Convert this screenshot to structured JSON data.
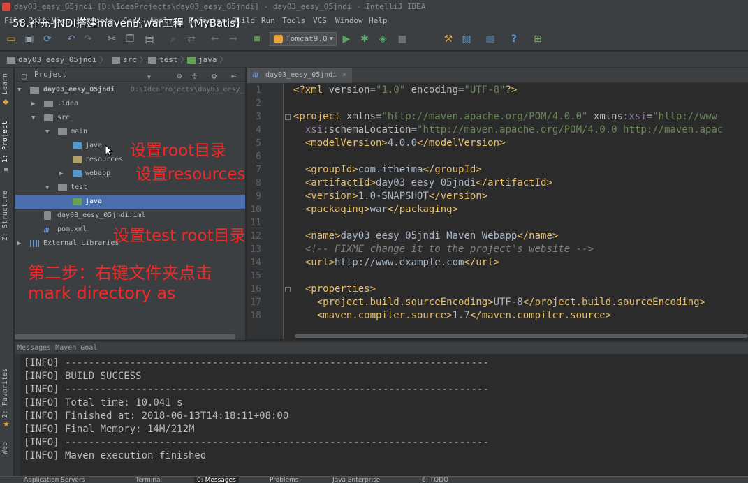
{
  "window": {
    "title": "day03_eesy_05jndi [D:\\IdeaProjects\\day03_eesy_05jndi] - day03_eesy_05jndi - IntelliJ IDEA",
    "overlay_title": "58.补充-JNDI搭建maven的war工程【MyBatis】"
  },
  "menu": [
    "File",
    "Edit",
    "View",
    "Navigate",
    "Code",
    "Analyze",
    "Refactor",
    "Build",
    "Run",
    "Tools",
    "VCS",
    "Window",
    "Help"
  ],
  "toolbar": {
    "run_config": "Tomcat9.0",
    "icons": [
      "open-icon",
      "save-icon",
      "sync-icon",
      "undo-icon",
      "redo-icon",
      "cut-icon",
      "copy-icon",
      "paste-icon",
      "find-icon",
      "replace-icon",
      "back-icon",
      "forward-icon",
      "build-icon",
      "run-icon",
      "debug-icon",
      "coverage-icon",
      "stop-icon",
      "project-structure-icon",
      "sdk-icon",
      "help-icon",
      "vcs-icon"
    ]
  },
  "breadcrumb": [
    "day03_eesy_05jndi",
    "src",
    "test",
    "java"
  ],
  "left_strip": {
    "tab_learn": "Learn",
    "tab_project": "1: Project",
    "tab_structure": "Z: Structure",
    "tab_favorites": "2: Favorites",
    "tab_web": "Web"
  },
  "project_panel": {
    "title": "Project",
    "tree": [
      {
        "label": "day03_eesy_05jndi",
        "hint": "D:\\IdeaProjects\\day03_eesy_",
        "level": 0,
        "arrow": "▼",
        "icon": "module"
      },
      {
        "label": ".idea",
        "level": 1,
        "arrow": "▶",
        "icon": "folder"
      },
      {
        "label": "src",
        "level": 1,
        "arrow": "▼",
        "icon": "folder"
      },
      {
        "label": "main",
        "level": 2,
        "arrow": "▼",
        "icon": "folder"
      },
      {
        "label": "java",
        "level": 3,
        "arrow": "",
        "icon": "source"
      },
      {
        "label": "resources",
        "level": 3,
        "arrow": "",
        "icon": "resource"
      },
      {
        "label": "webapp",
        "level": 3,
        "arrow": "▶",
        "icon": "folder"
      },
      {
        "label": "test",
        "level": 2,
        "arrow": "▼",
        "icon": "folder"
      },
      {
        "label": "java",
        "level": 3,
        "arrow": "",
        "icon": "test",
        "selected": true
      },
      {
        "label": "day03_eesy_05jndi.iml",
        "level": 1,
        "arrow": "",
        "icon": "iml"
      },
      {
        "label": "pom.xml",
        "level": 1,
        "arrow": "",
        "icon": "maven"
      },
      {
        "label": "External Libraries",
        "level": 0,
        "arrow": "▶",
        "icon": "lib"
      }
    ]
  },
  "annotations": {
    "root": "设置root目录",
    "resources": "设置resources目录",
    "test_root": "设置test root目录",
    "step_line1": "第二步：右键文件夹点击",
    "step_line2": "mark directory as"
  },
  "editor": {
    "tab_label": "day03_eesy_05jndi",
    "line_numbers": [
      "1",
      "2",
      "3",
      "4",
      "5",
      "6",
      "7",
      "8",
      "9",
      "10",
      "11",
      "12",
      "13",
      "14",
      "15",
      "16",
      "17",
      "18"
    ],
    "lines": [
      [
        {
          "t": "<?xml ",
          "c": "tag"
        },
        {
          "t": "version",
          "c": "attr"
        },
        {
          "t": "=",
          "c": "txt"
        },
        {
          "t": "\"1.0\"",
          "c": "val"
        },
        {
          "t": " encoding",
          "c": "attr"
        },
        {
          "t": "=",
          "c": "txt"
        },
        {
          "t": "\"UTF-8\"",
          "c": "val"
        },
        {
          "t": "?>",
          "c": "tag"
        }
      ],
      [],
      [
        {
          "t": "<project ",
          "c": "tag"
        },
        {
          "t": "xmlns",
          "c": "attr"
        },
        {
          "t": "=",
          "c": "txt"
        },
        {
          "t": "\"http://maven.apache.org/POM/4.0.0\"",
          "c": "val"
        },
        {
          "t": " xmlns",
          "c": "attr"
        },
        {
          "t": ":",
          "c": "txt"
        },
        {
          "t": "xsi",
          "c": "ns"
        },
        {
          "t": "=",
          "c": "txt"
        },
        {
          "t": "\"http://www",
          "c": "val"
        }
      ],
      [
        {
          "t": "  xsi",
          "c": "ns"
        },
        {
          "t": ":schemaLocation",
          "c": "attr"
        },
        {
          "t": "=",
          "c": "txt"
        },
        {
          "t": "\"http://maven.apache.org/POM/4.0.0 http://maven.apac",
          "c": "val"
        }
      ],
      [
        {
          "t": "  <modelVersion>",
          "c": "tag"
        },
        {
          "t": "4.0.0",
          "c": "txt"
        },
        {
          "t": "</modelVersion>",
          "c": "tag"
        }
      ],
      [],
      [
        {
          "t": "  <groupId>",
          "c": "tag"
        },
        {
          "t": "com.itheima",
          "c": "txt"
        },
        {
          "t": "</groupId>",
          "c": "tag"
        }
      ],
      [
        {
          "t": "  <artifactId>",
          "c": "tag"
        },
        {
          "t": "day03_eesy_05jndi",
          "c": "txt"
        },
        {
          "t": "</artifactId>",
          "c": "tag"
        }
      ],
      [
        {
          "t": "  <version>",
          "c": "tag"
        },
        {
          "t": "1.0-SNAPSHOT",
          "c": "txt"
        },
        {
          "t": "</version>",
          "c": "tag"
        }
      ],
      [
        {
          "t": "  <packaging>",
          "c": "tag"
        },
        {
          "t": "war",
          "c": "txt"
        },
        {
          "t": "</packaging>",
          "c": "tag"
        }
      ],
      [],
      [
        {
          "t": "  <name>",
          "c": "tag"
        },
        {
          "t": "day03_eesy_05jndi Maven Webapp",
          "c": "txt"
        },
        {
          "t": "</name>",
          "c": "tag"
        }
      ],
      [
        {
          "t": "  <!-- ",
          "c": "cmt"
        },
        {
          "t": "FIXME change it to the project's website",
          "c": "cmt"
        },
        {
          "t": " -->",
          "c": "cmt"
        }
      ],
      [
        {
          "t": "  <url>",
          "c": "tag"
        },
        {
          "t": "http://www.example.com",
          "c": "txt"
        },
        {
          "t": "</url>",
          "c": "tag"
        }
      ],
      [],
      [
        {
          "t": "  <properties>",
          "c": "tag"
        }
      ],
      [
        {
          "t": "    <project.build.sourceEncoding>",
          "c": "tag"
        },
        {
          "t": "UTF-8",
          "c": "txt"
        },
        {
          "t": "</project.build.sourceEncoding>",
          "c": "tag"
        }
      ],
      [
        {
          "t": "    <maven.compiler.source>",
          "c": "tag"
        },
        {
          "t": "1.7",
          "c": "txt"
        },
        {
          "t": "</maven.compiler.source>",
          "c": "tag"
        }
      ]
    ]
  },
  "messages": {
    "header": "Messages Maven Goal",
    "lines": [
      "[INFO] ------------------------------------------------------------------------",
      "[INFO] BUILD SUCCESS",
      "[INFO] ------------------------------------------------------------------------",
      "[INFO] Total time: 10.041 s",
      "[INFO] Finished at: 2018-06-13T14:18:11+08:00",
      "[INFO] Final Memory: 14M/212M",
      "[INFO] ------------------------------------------------------------------------",
      "[INFO] Maven execution finished"
    ]
  },
  "statusbar": {
    "tabs": [
      "Application Servers",
      "Terminal",
      "0: Messages",
      "Problems",
      "Java Enterprise",
      "6: TODO"
    ]
  }
}
